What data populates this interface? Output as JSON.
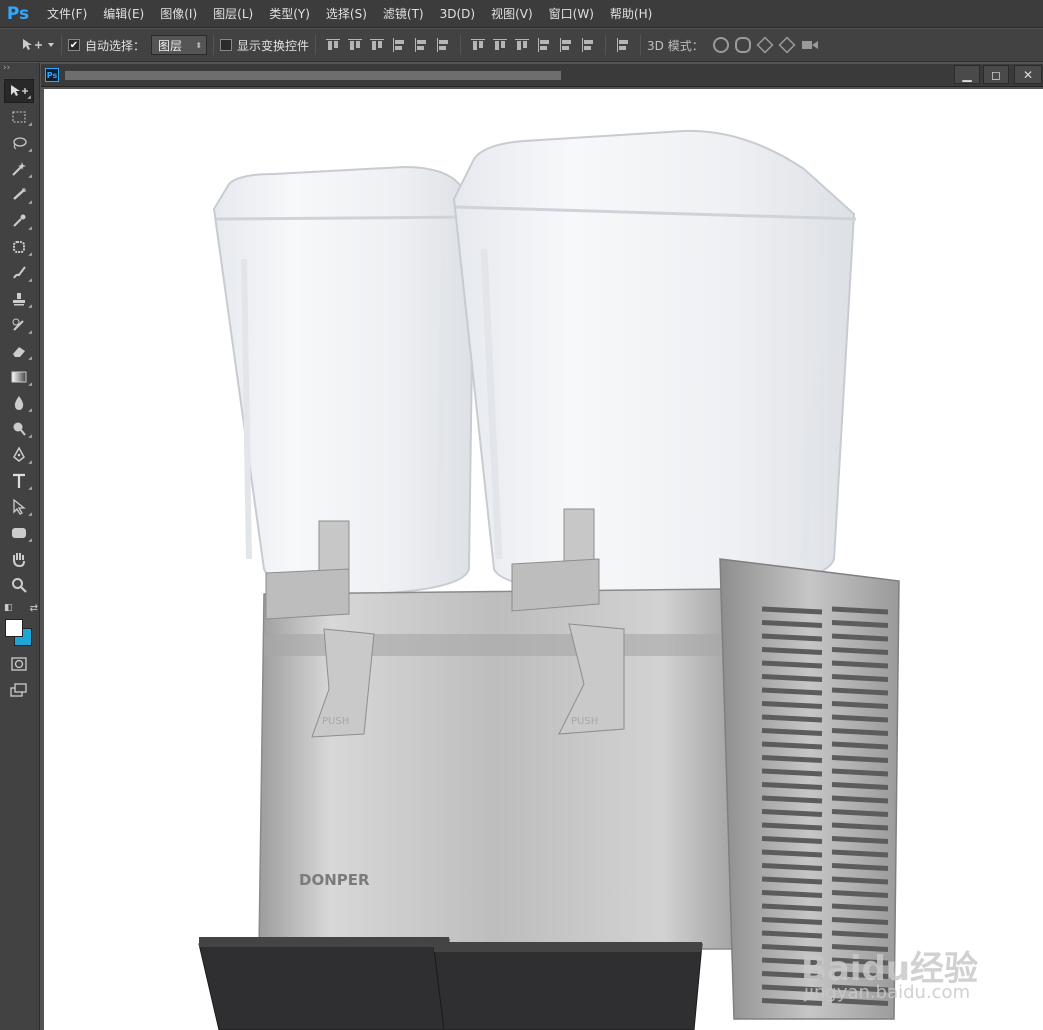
{
  "app": {
    "logo": "Ps"
  },
  "menu": [
    "文件(F)",
    "编辑(E)",
    "图像(I)",
    "图层(L)",
    "类型(Y)",
    "选择(S)",
    "滤镜(T)",
    "3D(D)",
    "视图(V)",
    "窗口(W)",
    "帮助(H)"
  ],
  "options": {
    "auto_select_label": "自动选择：",
    "auto_select_checked": true,
    "layer_select_value": "图层",
    "show_transform_label": "显示变换控件",
    "mode_3d_label": "3D 模式："
  },
  "document": {
    "tab_icon": "Ps",
    "minimize_glyph": "▁",
    "restore_glyph": "◻",
    "close_glyph": "✕"
  },
  "canvas_image": {
    "brand_text": "DONPER",
    "push_label": "PUSH"
  },
  "watermark": {
    "brand": "Baidu经验",
    "url": "jingyan.baidu.com"
  },
  "colors": {
    "foreground": "#ffffff",
    "background": "#1ea7d6",
    "accent": "#31a8ff"
  }
}
